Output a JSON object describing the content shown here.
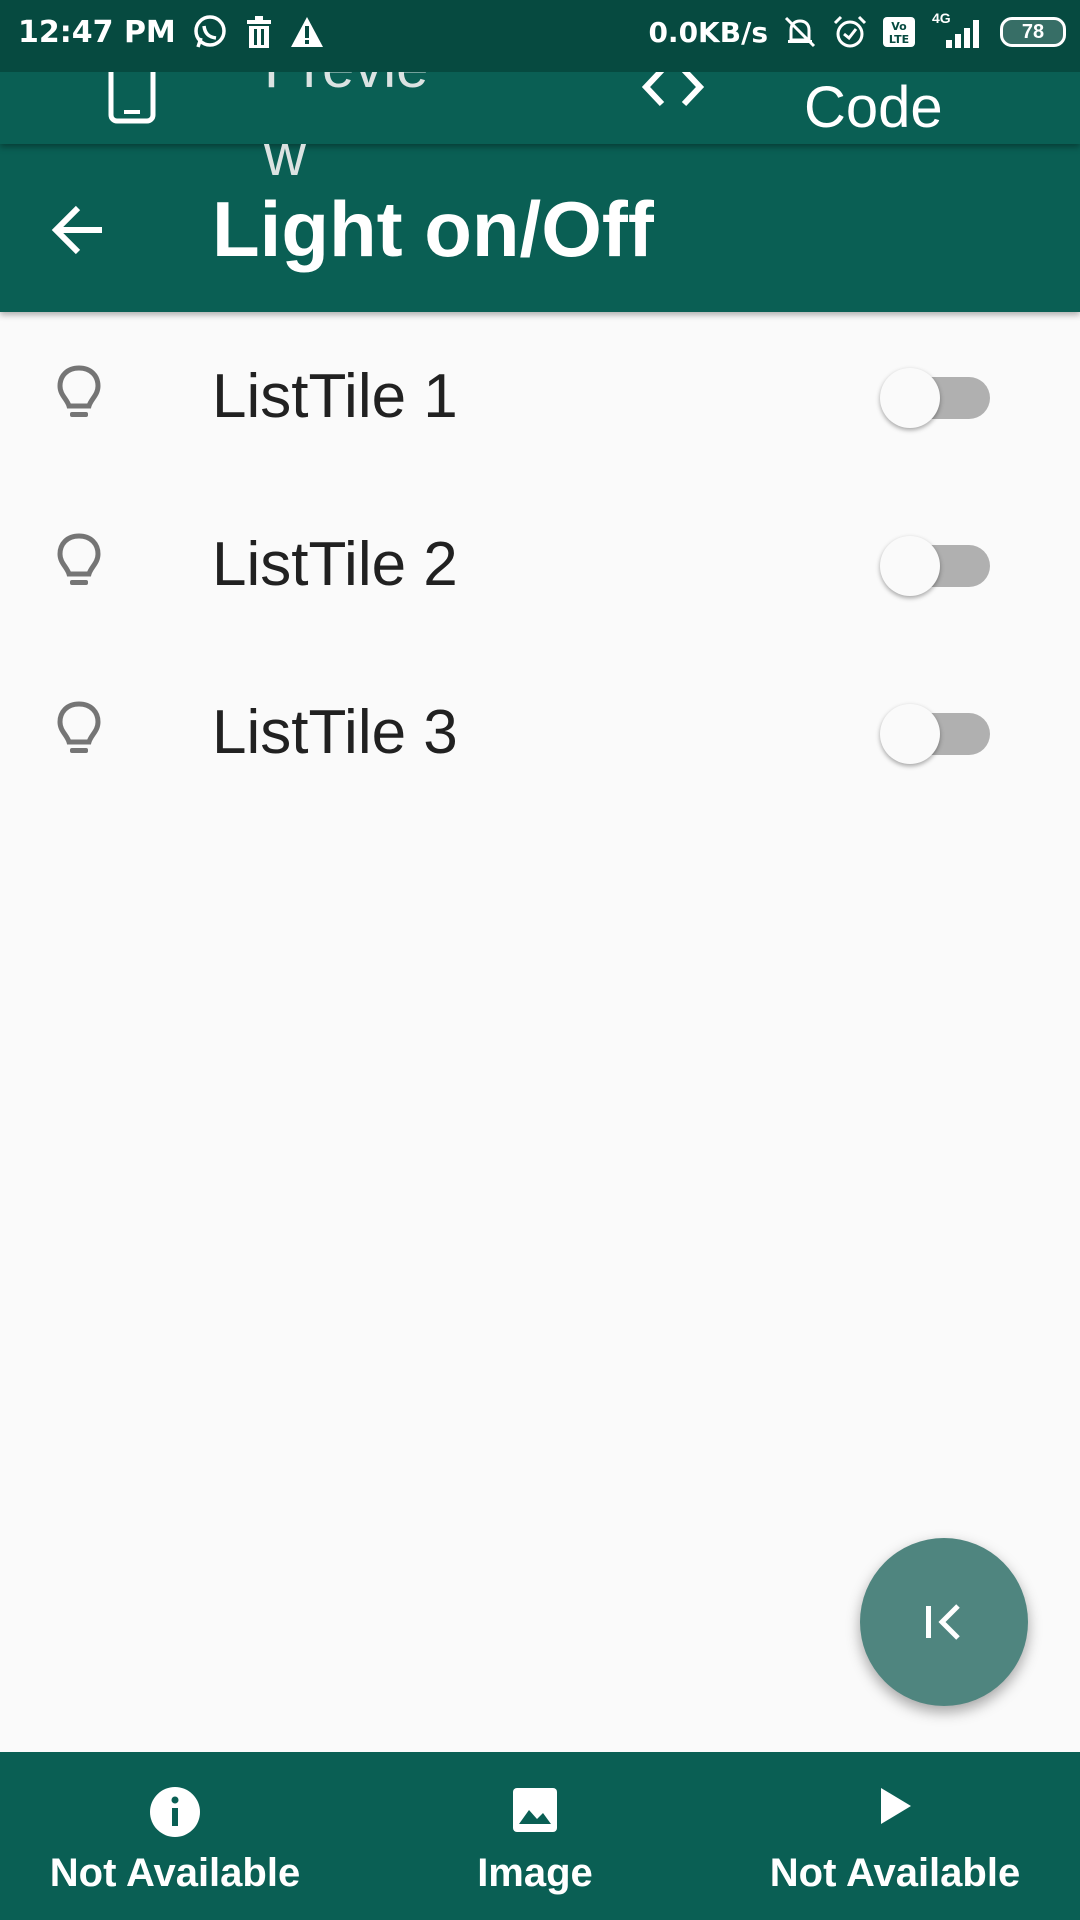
{
  "status_bar": {
    "time": "12:47 PM",
    "net_speed": "0.0KB/s",
    "network": "4G",
    "volte": "Vo LTE",
    "battery": "78",
    "left_icons": [
      "whatsapp-icon",
      "trash-icon",
      "warning-icon"
    ],
    "right_icons": [
      "mute-notifications-icon",
      "alarm-icon",
      "volte-icon",
      "signal-icon",
      "battery-icon"
    ]
  },
  "top_tabs": {
    "preview_label": "Preview",
    "code_label": "Code"
  },
  "app_bar": {
    "title": "Light on/Off"
  },
  "list": {
    "items": [
      {
        "label": "ListTile 1",
        "icon": "lightbulb-icon",
        "switch_on": false
      },
      {
        "label": "ListTile 2",
        "icon": "lightbulb-icon",
        "switch_on": false
      },
      {
        "label": "ListTile 3",
        "icon": "lightbulb-icon",
        "switch_on": false
      }
    ]
  },
  "fab": {
    "icon": "collapse-left-icon"
  },
  "bottom_nav": {
    "items": [
      {
        "label": "Not Available",
        "icon": "info-icon"
      },
      {
        "label": "Image",
        "icon": "image-icon"
      },
      {
        "label": "Not Available",
        "icon": "play-icon"
      }
    ]
  },
  "colors": {
    "primary": "#0a5f54",
    "status_bar": "#064a40",
    "fab": "#4f857f",
    "background": "#fafafa"
  }
}
